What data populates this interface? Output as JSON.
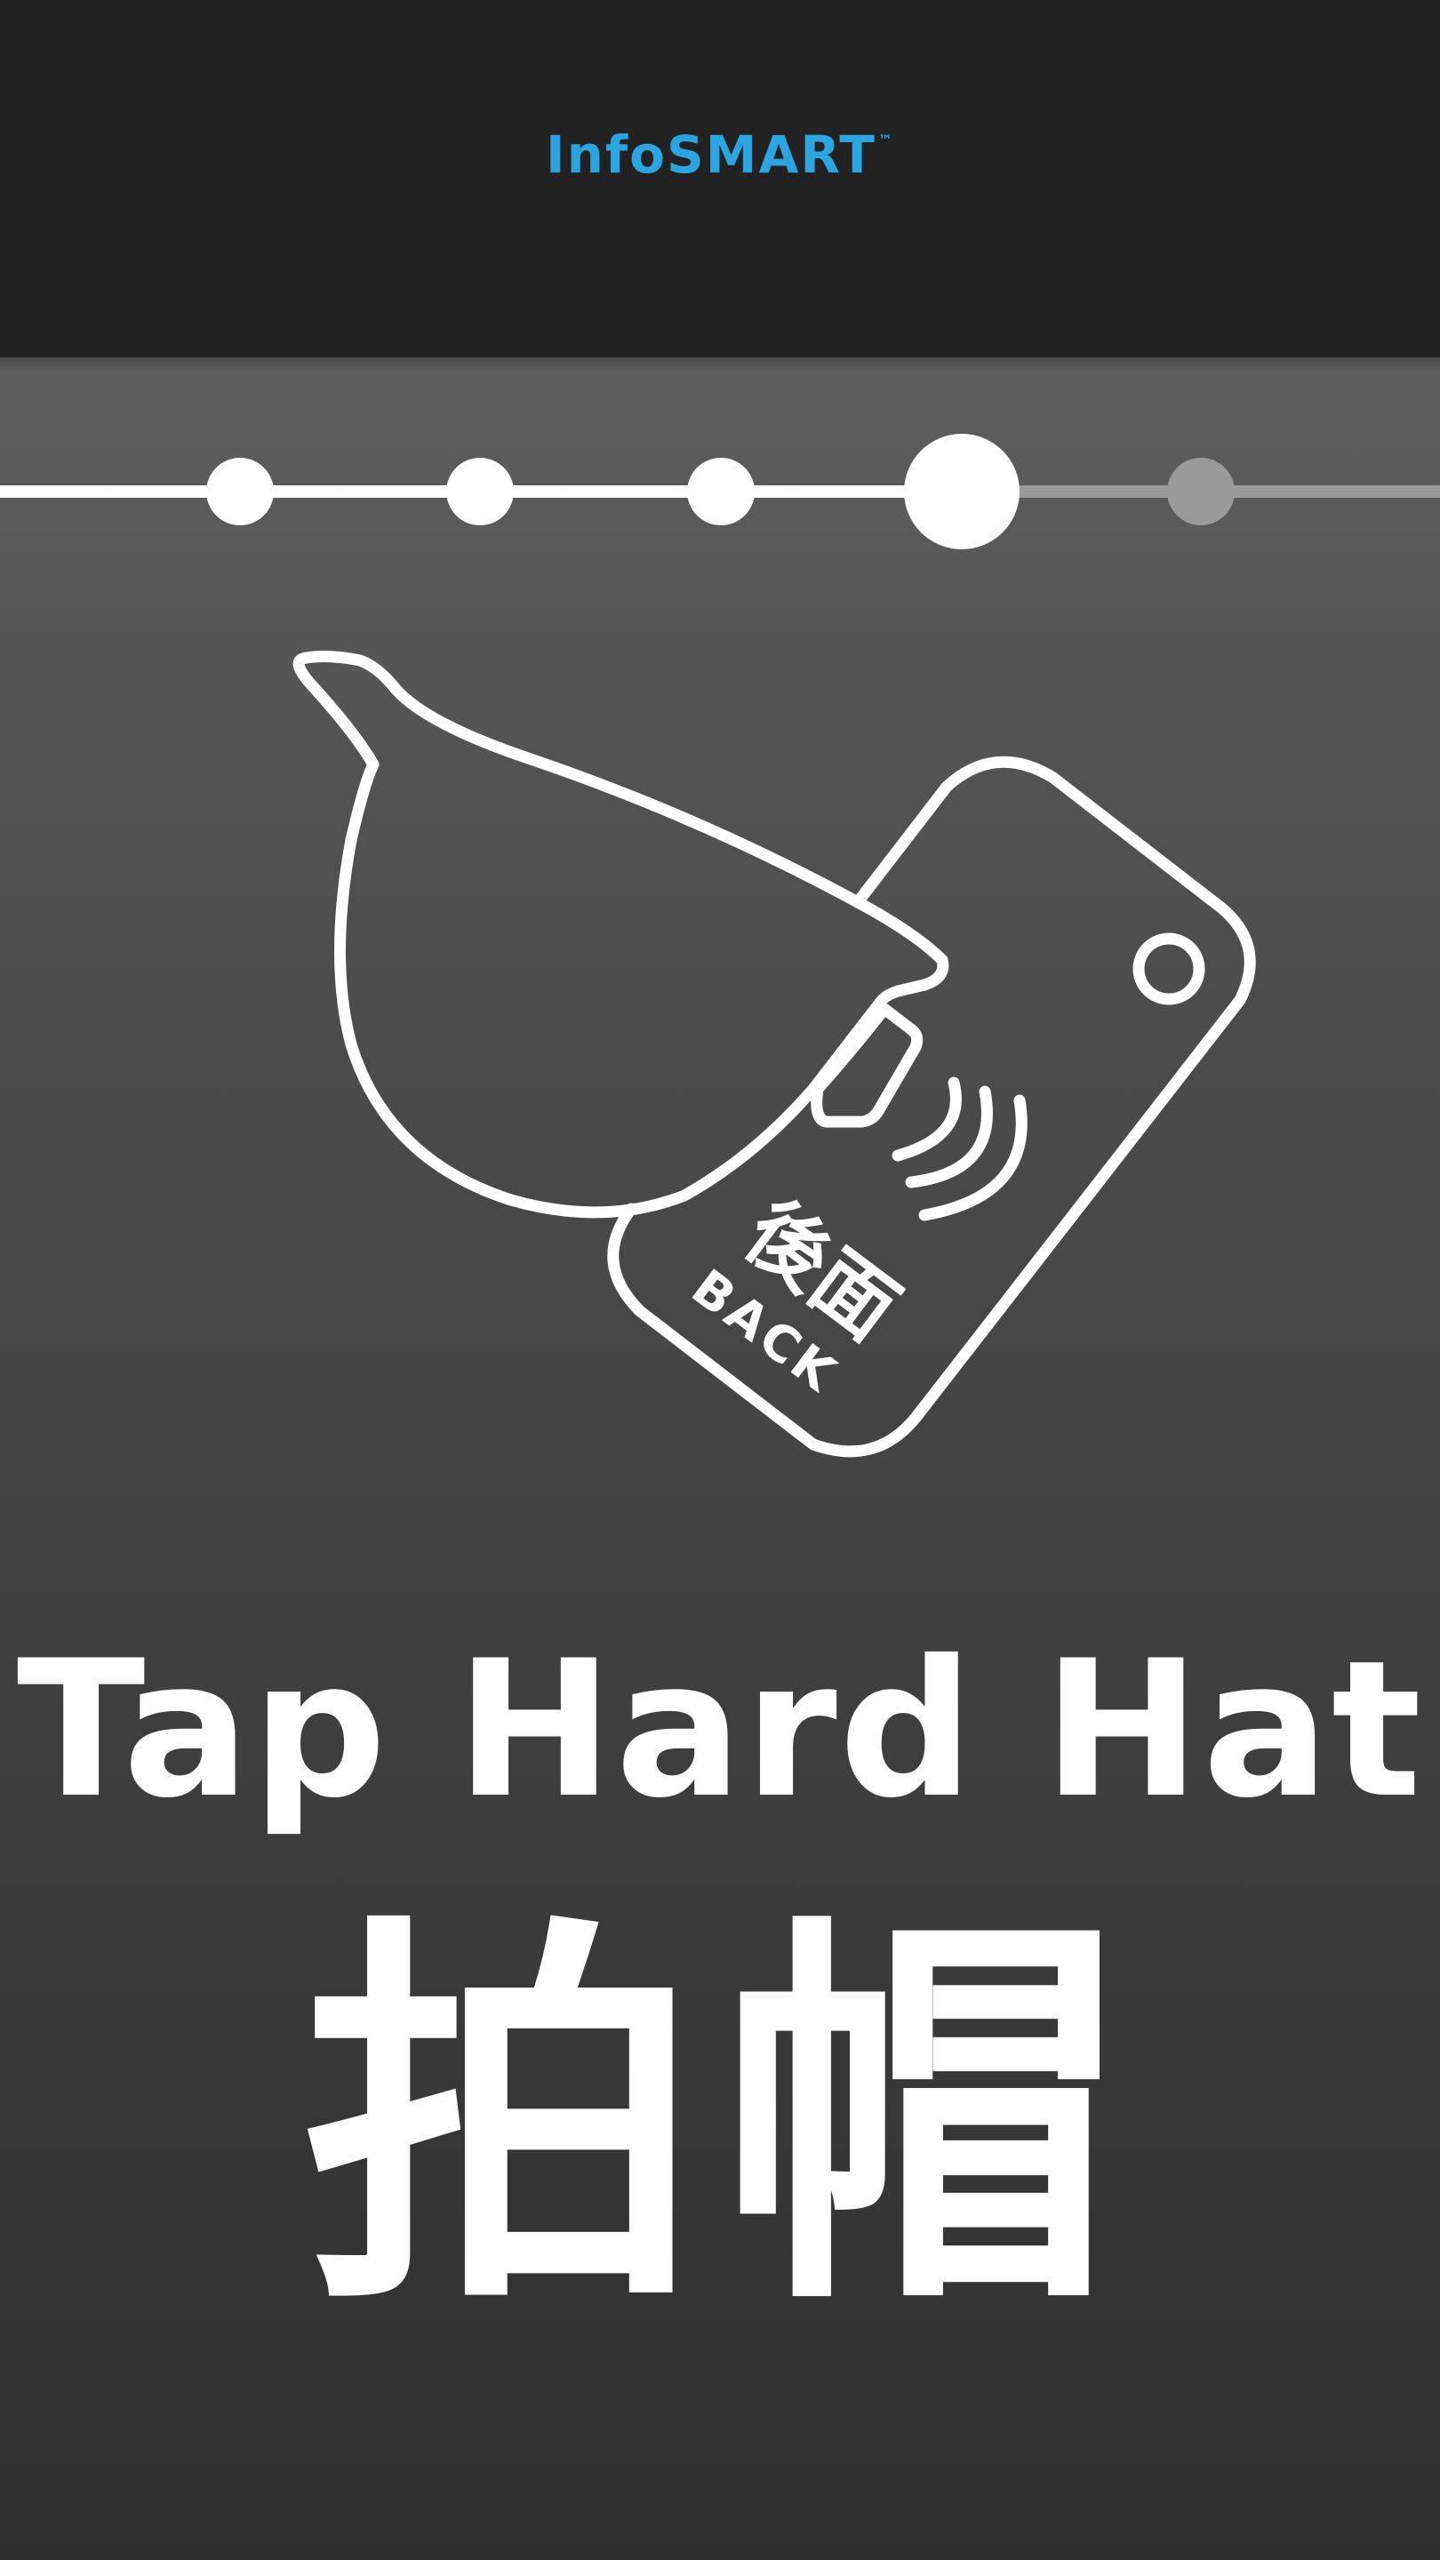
{
  "header": {
    "brand": "InfoSMART",
    "trademark": "™",
    "brand_color": "#2aa5e0"
  },
  "stepper": {
    "total_steps": 5,
    "current_step": 4,
    "completed_color": "#ffffff",
    "pending_color": "#9a9a9a"
  },
  "illustration": {
    "icon": "hand-tapping-hard-hat-icon",
    "hat_back_label_zh": "後面",
    "hat_back_label_en": "BACK"
  },
  "instruction": {
    "title_en": "Tap Hard Hat",
    "title_zh": "拍帽"
  }
}
